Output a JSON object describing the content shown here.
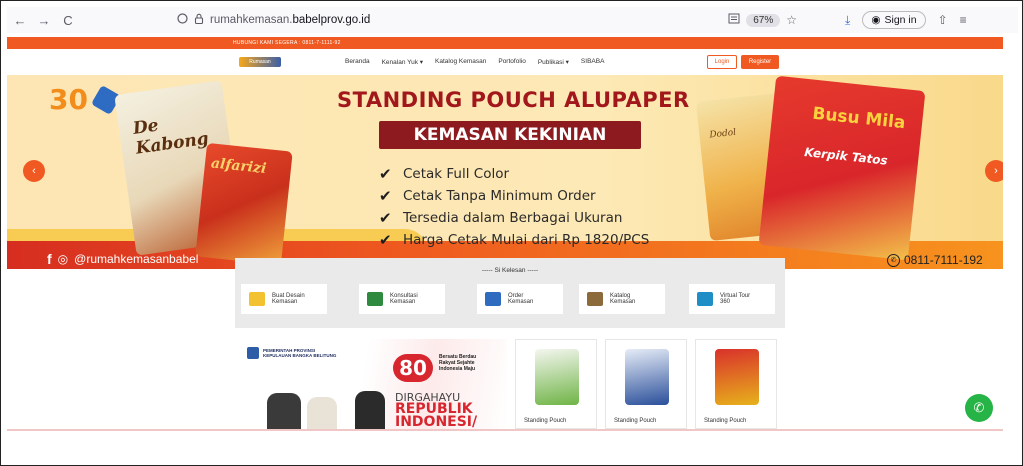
{
  "browser": {
    "back": "←",
    "forward": "→",
    "reload": "C",
    "url_domain_prefix": "rumahkemasan.",
    "url_domain_main": "babelprov.go.id",
    "zoom": "67%",
    "sign_in": "Sign in"
  },
  "site": {
    "hotline": "HUBUNGI KAMI SEGERA :  0811-7-1111-92",
    "logo_text": "Rumasan",
    "nav": [
      {
        "label": "Beranda"
      },
      {
        "label": "Kenalan Yuk ▾"
      },
      {
        "label": "Katalog Kemasan"
      },
      {
        "label": "Portofolio"
      },
      {
        "label": "Publikasi ▾"
      },
      {
        "label": "SIBABA"
      }
    ],
    "login": "Login",
    "register": "Register"
  },
  "banner": {
    "headline": "STANDING POUCH ALUPAPER",
    "subhead": "KEMASAN KEKINIAN",
    "features": [
      "Cetak Full Color",
      "Cetak Tanpa Minimum Order",
      "Tersedia dalam Berbagai Ukuran",
      "Harga Cetak Mulai dari Rp 1820/PCS"
    ],
    "social_handle": "@rumahkemasanbabel",
    "phone": "0811-7111-192",
    "logo_num": "30",
    "pouch_a": "De Kabong",
    "pouch_b": "alfarizi",
    "pouch_c": "Dodol",
    "pouch_d": "Busu Mila",
    "pouch_d_sub": "Kerpik Tatos",
    "colors": {
      "accent": "#f05a22",
      "headline": "#a1171b",
      "subhead_bg": "#8c1a1f"
    }
  },
  "services": {
    "title": "----- Si Kelesan -----",
    "items": [
      {
        "line1": "Buat Desain",
        "line2": "Kemasan",
        "color": "#f2c230"
      },
      {
        "line1": "Konsultasi",
        "line2": "Kemasan",
        "color": "#2d8a3e"
      },
      {
        "line1": "Order",
        "line2": "Kemasan",
        "color": "#2f6bbf"
      },
      {
        "line1": "Katalog",
        "line2": "Kemasan",
        "color": "#8b6a3b"
      },
      {
        "line1": "Virtual Tour",
        "line2": "360",
        "color": "#1f8ec7"
      }
    ]
  },
  "promo": {
    "gov_line1": "PEMERINTAH PROVINSI",
    "gov_line2": "KEPULAUAN BANGKA BELITUNG",
    "num": "80",
    "slogan1": "Bersatu Berdau",
    "slogan2": "Rakyat Sejahte",
    "slogan3": "Indonesia Maju",
    "dirgahayu": "DIRGAHAYU",
    "republik": "REPUBLIK",
    "indonesia": "INDONESI/"
  },
  "products": [
    {
      "label": "Standing Pouch",
      "color": "#6fb446"
    },
    {
      "label": "Standing Pouch",
      "color": "#2a4f9a"
    },
    {
      "label": "Standing Pouch",
      "color": "#e7b21c"
    }
  ]
}
